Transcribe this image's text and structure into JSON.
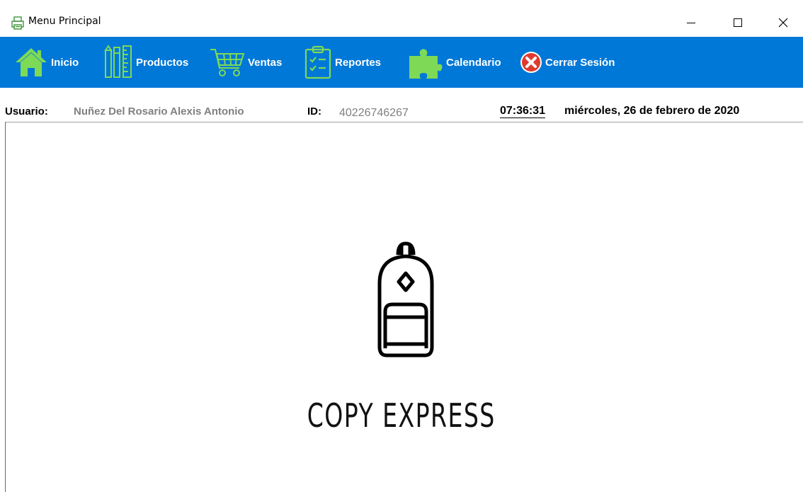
{
  "window": {
    "title": "Menu Principal",
    "icon": "printer-icon"
  },
  "menu": {
    "items": [
      {
        "label": "Inicio",
        "icon": "home-icon"
      },
      {
        "label": "Productos",
        "icon": "pencils-ruler-icon"
      },
      {
        "label": "Ventas",
        "icon": "shopping-cart-icon"
      },
      {
        "label": "Reportes",
        "icon": "clipboard-checklist-icon"
      },
      {
        "label": "Calendario",
        "icon": "puzzle-icon"
      },
      {
        "label": "Cerrar Sesión",
        "icon": "close-circle-icon"
      }
    ],
    "bar_color": "#0078d7",
    "icon_color": "#7ed957"
  },
  "info": {
    "usuario_label": "Usuario:",
    "usuario_value": "Nuñez Del Rosario  Alexis Antonio",
    "id_label": "ID:",
    "id_value": "40226746267",
    "time": "07:36:31",
    "date": "miércoles, 26 de febrero de 2020"
  },
  "main": {
    "logo_icon": "backpack-icon",
    "brand": "COPY EXPRESS"
  }
}
